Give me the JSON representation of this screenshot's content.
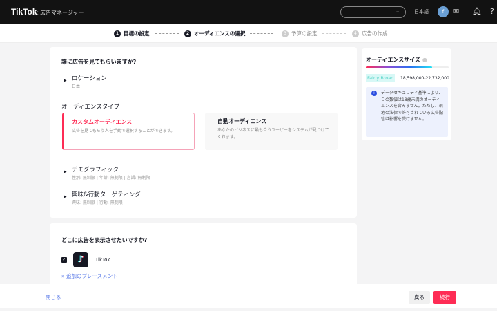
{
  "header": {
    "logo": "TikTok",
    "logo_sub": ": 広告マネージャー",
    "language": "日本語",
    "avatar_letter": "f"
  },
  "steps": [
    {
      "num": "1",
      "label": "目標の設定"
    },
    {
      "num": "2",
      "label": "オーディエンスの選択"
    },
    {
      "num": "3",
      "label": "予算の設定"
    },
    {
      "num": "4",
      "label": "広告の作成"
    }
  ],
  "audience": {
    "title": "誰に広告を見てもらいますか?",
    "location": {
      "label": "ロケーション",
      "value": "日本"
    },
    "type_heading": "オーディエンスタイプ",
    "custom": {
      "title": "カスタムオーディエンス",
      "desc": "広告を見てもらう人を手動で選択することができます。"
    },
    "auto": {
      "title": "自動オーディエンス",
      "desc": "あなたのビジネスに最も合うユーザーをシステムが見つけてくれます。"
    },
    "demographic": {
      "label": "デモグラフィック",
      "value": "性別: 無制限 | 年齢: 無制限 | 言語: 無制限"
    },
    "interest": {
      "label": "興味&行動ターゲティング",
      "value": "興味: 無制限 | 行動: 無制限"
    }
  },
  "placement": {
    "title": "どこに広告を表示させたいですか?",
    "app": "TikTok",
    "more": "追加のプレースメント"
  },
  "size": {
    "title": "オーディエンスサイズ",
    "badge": "Fairly Broad",
    "range": "18,598,000-22,732,000",
    "fill_percent": 80,
    "notice": "データセキュリティ基準により、この数値は18歳未満のオーディエンスを含みません。ただし、現地の法律で許可されている広告配信は影響を受けません。"
  },
  "footer": {
    "close": "閉じる",
    "back": "戻る",
    "next": "続行"
  },
  "colors": {
    "accent": "#fe2c55",
    "link": "#5b7be8"
  }
}
